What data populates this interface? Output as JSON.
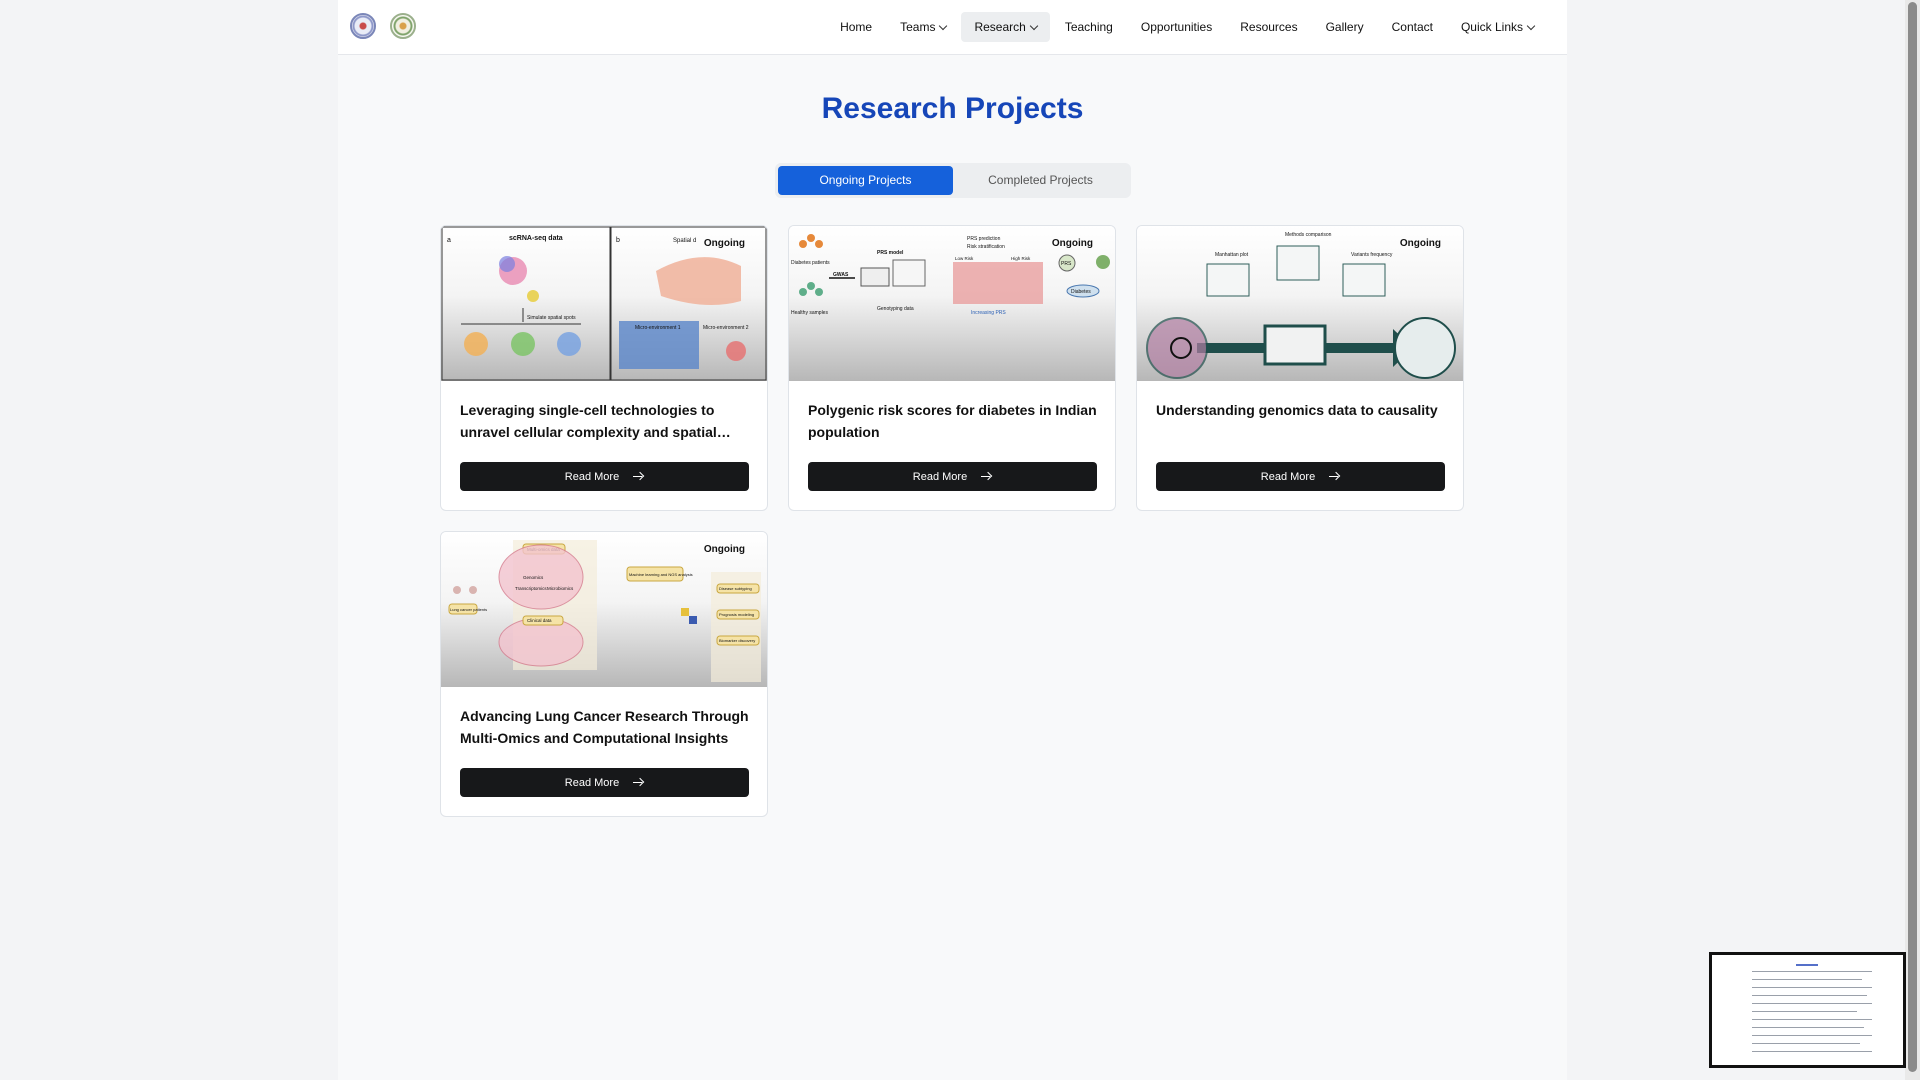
{
  "nav": {
    "items": [
      {
        "label": "Home",
        "dropdown": false,
        "active": false
      },
      {
        "label": "Teams",
        "dropdown": true,
        "active": false
      },
      {
        "label": "Research",
        "dropdown": true,
        "active": true
      },
      {
        "label": "Teaching",
        "dropdown": false,
        "active": false
      },
      {
        "label": "Opportunities",
        "dropdown": false,
        "active": false
      },
      {
        "label": "Resources",
        "dropdown": false,
        "active": false
      },
      {
        "label": "Gallery",
        "dropdown": false,
        "active": false
      },
      {
        "label": "Contact",
        "dropdown": false,
        "active": false
      },
      {
        "label": "Quick Links",
        "dropdown": true,
        "active": false
      }
    ]
  },
  "page": {
    "title": "Research Projects"
  },
  "tabs": {
    "ongoing": "Ongoing Projects",
    "completed": "Completed Projects",
    "active": "ongoing"
  },
  "projects": [
    {
      "status": "Ongoing",
      "title": "Leveraging single-cell technologies to unravel cellular complexity and spatial organization",
      "button": "Read More",
      "image_labels": [
        "a",
        "scRNA-seq data",
        "b",
        "Spatial d",
        "Simulate spatial spots",
        "Micro-environment 1",
        "Micro-environment 2"
      ]
    },
    {
      "status": "Ongoing",
      "title": "Polygenic risk scores for diabetes in Indian population",
      "button": "Read More",
      "image_labels": [
        "Diabetes patients",
        "GWAS",
        "PRS model",
        "PRS prediction",
        "Risk stratification",
        "Low Risk",
        "High Risk",
        "Increasing PRS",
        "PRS",
        "Diabetes",
        "Healthy samples",
        "Genotyping data"
      ]
    },
    {
      "status": "Ongoing",
      "title": "Understanding genomics data to causality",
      "button": "Read More",
      "image_labels": [
        "Manhattan plot",
        "Methods comparison",
        "Variants frequency"
      ]
    },
    {
      "status": "Ongoing",
      "title": "Advancing Lung Cancer Research Through Multi-Omics and Computational Insights",
      "button": "Read More",
      "image_labels": [
        "Multi-omics data",
        "Genomics",
        "Transcriptomics",
        "Microbiomics",
        "Clinical data",
        "Machine learning and NGS analysis",
        "Disease subtyping",
        "Prognosis modeling",
        "Biomarker discovery",
        "Lung cancer patients"
      ]
    }
  ]
}
